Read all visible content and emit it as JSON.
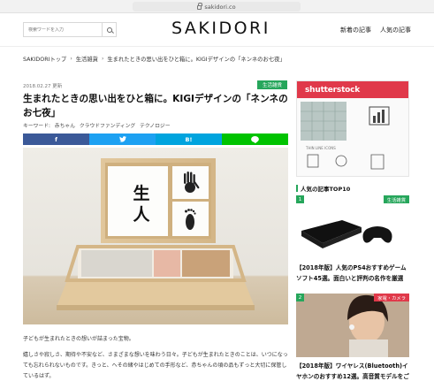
{
  "browser": {
    "url": "sakidori.co"
  },
  "header": {
    "search_placeholder": "検索ワードを入力",
    "logo": "SAKIDORI",
    "nav": [
      "新着の記事",
      "人気の記事"
    ]
  },
  "breadcrumb": [
    "SAKIDORIトップ",
    "生活雑貨",
    "生まれたときの思い出をひと箱に。KIGIデザインの「ネンネのお七夜」"
  ],
  "article": {
    "date": "2018.02.27 更新",
    "category": "生活雑貨",
    "title": "生まれたときの思い出をひと箱に。KIGIデザインの「ネンネのお七夜」",
    "keywords_label": "キーワード:",
    "keywords": [
      "赤ちゃん",
      "クラウドファンディング",
      "テクノロジー"
    ],
    "share": {
      "twitter": "",
      "hatena": "B!",
      "line": ""
    },
    "hero_calligraphy": "生\n人",
    "body": [
      "子どもが生まれたときの想いが詰まった宝物。",
      "嬉しさや寂しさ、期待や不安など、さまざまな想いを味わう日々。子どもが生まれたときのことは、いつになっても忘れられないものです。きっと、へその緒やはじめての手形など、赤ちゃんの頃の品もずっと大切に保管しているはず。"
    ]
  },
  "sidebar": {
    "ad_brand": "shutterstock",
    "ad_caption": "THIN LINE ICONS",
    "ranking_title": "人気の記事TOP10",
    "items": [
      {
        "rank": "1",
        "category": "生活雑貨",
        "category_color": "#26a65b",
        "title": "【2018年版】人気のPS4おすすめゲームソフト45選。面白いと評判の名作を厳選"
      },
      {
        "rank": "2",
        "category": "家電・カメラ",
        "category_color": "#e0394a",
        "title": "【2018年版】ワイヤレス(Bluetooth)イヤホンのおすすめ12選。高音質モデルをご"
      }
    ]
  },
  "colors": {
    "accent": "#26a65b",
    "facebook": "#3b5998",
    "twitter": "#1da1f2",
    "hatena": "#00a4de",
    "line": "#00c300"
  }
}
